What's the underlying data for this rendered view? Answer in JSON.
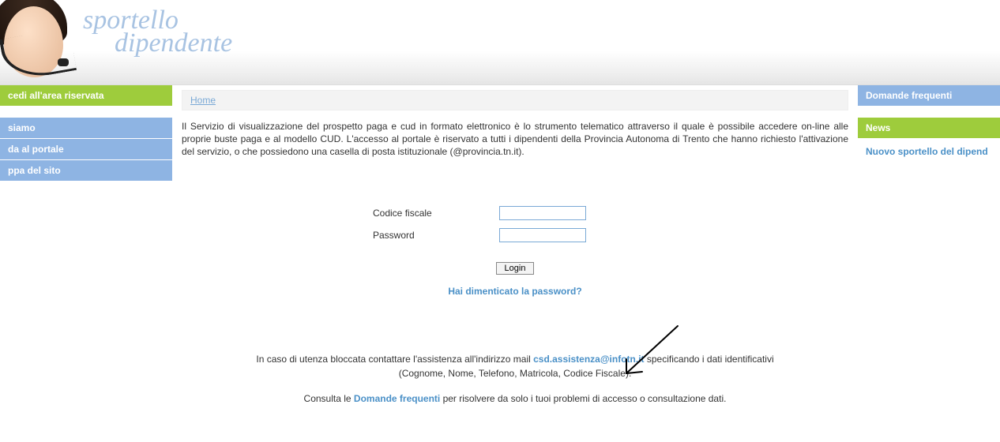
{
  "logo": {
    "line1": "sportello",
    "line2": "dipendente"
  },
  "sidebar": {
    "items": [
      {
        "label": "cedi all'area riservata",
        "style": "green"
      },
      {
        "label": "siamo",
        "style": "blue"
      },
      {
        "label": "da al portale",
        "style": "blue"
      },
      {
        "label": "ppa del sito",
        "style": "blue"
      }
    ]
  },
  "breadcrumb": {
    "home": "Home"
  },
  "intro": "Il Servizio di visualizzazione del prospetto paga e cud in formato elettronico  è lo strumento telematico attraverso il quale è possibile accedere on-line alle proprie buste paga e al modello CUD. L'accesso al portale è riservato a tutti i dipendenti della Provincia Autonoma di Trento che hanno richiesto l'attivazione del servizio, o che possiedono una casella di posta istituzionale (@provincia.tn.it).",
  "form": {
    "cf_label": "Codice fiscale",
    "cf_value": "",
    "pwd_label": "Password",
    "pwd_value": "",
    "login_btn": "Login",
    "forgot": "Hai dimenticato la password?"
  },
  "assist": {
    "line1_pre": "In caso di utenza bloccata contattare l'assistenza all'indirizzo mail ",
    "email": "csd.assistenza@infotn.it",
    "line1_post": " specificando i dati identificativi",
    "line2": "(Cognome, Nome, Telefono, Matricola, Codice Fiscale).",
    "line3_pre": "Consulta le ",
    "faq_link": "Domande frequenti",
    "line3_post": " per risolvere da solo i tuoi problemi di accesso o consultazione dati."
  },
  "right": {
    "faq": "Domande frequenti",
    "news": "News",
    "news_link": "Nuovo sportello del dipend"
  }
}
